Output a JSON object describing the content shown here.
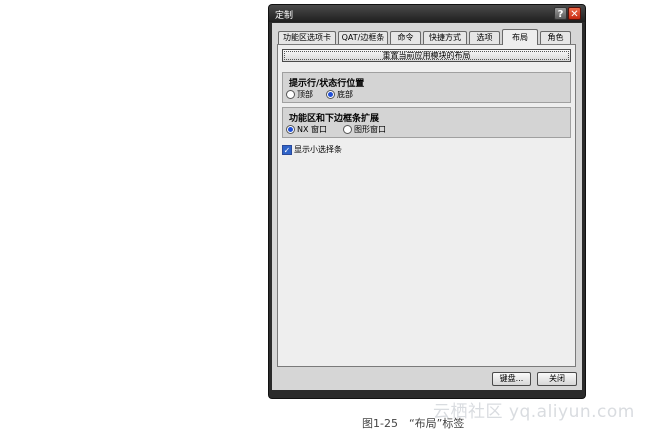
{
  "dialog": {
    "title": "定制",
    "help_label": "?",
    "close_label": "✕",
    "tabs": [
      {
        "label": "功能区选项卡"
      },
      {
        "label": "QAT/边框条"
      },
      {
        "label": "命令"
      },
      {
        "label": "快捷方式"
      },
      {
        "label": "选项"
      },
      {
        "label": "布局",
        "active": true
      },
      {
        "label": "角色"
      }
    ],
    "reset_button": "重置当前应用模块的布局",
    "prompt_group": {
      "title": "提示行/状态行位置",
      "options": [
        {
          "label": "顶部",
          "selected": false
        },
        {
          "label": "底部",
          "selected": true
        }
      ]
    },
    "ribbon_group": {
      "title": "功能区和下边框条扩展",
      "options": [
        {
          "label": "NX 窗口",
          "selected": true
        },
        {
          "label": "图形窗口",
          "selected": false
        }
      ]
    },
    "checkbox": {
      "label": "显示小选择条",
      "checked": true
    },
    "ok_button": "键盘...",
    "cancel_button": "关闭"
  },
  "caption": "图1-25　“布局”标签",
  "watermark": "云栖社区 yq.aliyun.com"
}
